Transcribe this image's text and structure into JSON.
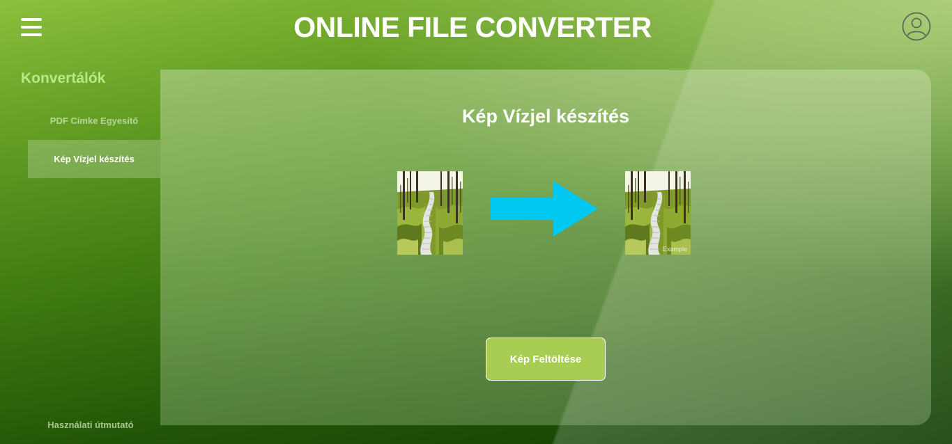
{
  "header": {
    "title": "ONLINE FILE CONVERTER",
    "menu_icon": "hamburger-icon",
    "user_icon": "user-icon"
  },
  "sidebar": {
    "heading": "Konvertálók",
    "items": [
      {
        "label": "PDF Címke Egyesítő",
        "active": false
      },
      {
        "label": "Kép Vízjel készítés",
        "active": true
      }
    ],
    "footer_link": "Használati útmutató"
  },
  "main": {
    "title": "Kép Vízjel készítés",
    "example": {
      "before_image": "forest-path-image",
      "arrow_icon": "arrow-right-icon",
      "after_image": "forest-path-watermarked-image",
      "watermark_text": "Example"
    },
    "upload_button": "Kép Feltöltése"
  },
  "colors": {
    "accent_green": "#a9cc52",
    "sidebar_heading": "#b8e986",
    "arrow": "#00c8f0"
  }
}
